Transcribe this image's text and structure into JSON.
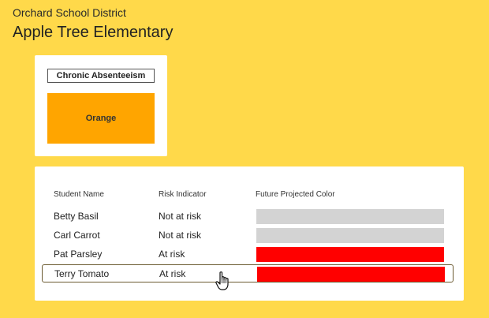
{
  "header": {
    "district": "Orchard School District",
    "school": "Apple Tree Elementary"
  },
  "metric": {
    "label": "Chronic Absenteeism",
    "value": "Orange",
    "color": "#ffa500"
  },
  "table": {
    "columns": [
      "Student Name",
      "Risk Indicator",
      "Future Projected Color"
    ],
    "rows": [
      {
        "name": "Betty Basil",
        "risk": "Not at risk",
        "color": "#d3d3d3"
      },
      {
        "name": "Carl Carrot",
        "risk": "Not at risk",
        "color": "#d3d3d3"
      },
      {
        "name": "Pat Parsley",
        "risk": "At risk",
        "color": "#ff0000"
      },
      {
        "name": "Terry Tomato",
        "risk": "At risk",
        "color": "#ff0000",
        "selected": true
      }
    ]
  },
  "cursor": {
    "icon": "hand-pointer-icon"
  }
}
